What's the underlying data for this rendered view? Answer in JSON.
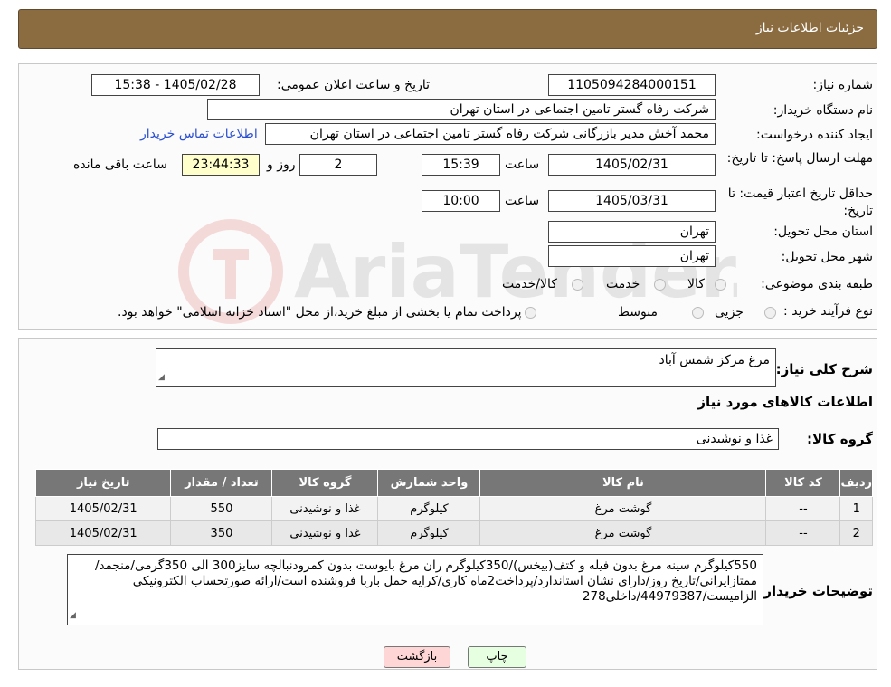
{
  "header": {
    "title": "جزئیات اطلاعات نیاز"
  },
  "labels": {
    "need_number": "شماره نیاز:",
    "announce_datetime": "تاریخ و ساعت اعلان عمومی:",
    "buyer_org": "نام دستگاه خریدار:",
    "requester": "ایجاد کننده درخواست:",
    "deadline": "مهلت ارسال پاسخ: تا تاریخ:",
    "price_validity": "حداقل تاریخ اعتبار قیمت: تا تاریخ:",
    "hour1": "ساعت",
    "hour2": "ساعت",
    "day_and": "روز و",
    "time_remaining": "ساعت باقی مانده",
    "province": "استان محل تحویل:",
    "city": "شهر محل تحویل:",
    "category": "طبقه بندی موضوعی:",
    "process_type": "نوع فرآیند خرید :",
    "payment_note": "پرداخت تمام یا بخشی از مبلغ خرید،از محل \"اسناد خزانه اسلامی\" خواهد بود."
  },
  "values": {
    "need_number": "1105094284000151",
    "announce_datetime": "1405/02/28 - 15:38",
    "buyer_org": "شرکت رفاه گستر تامین اجتماعی در استان تهران",
    "requester": "محمد آخش مدیر بازرگانی شرکت رفاه گستر تامین اجتماعی در استان تهران",
    "buyer_contact_link": "اطلاعات تماس خریدار",
    "deadline_date": "1405/02/31",
    "deadline_time": "15:39",
    "days": "2",
    "remaining": "23:44:33",
    "validity_date": "1405/03/31",
    "validity_time": "10:00",
    "province": "تهران",
    "city": "تهران"
  },
  "category_options": [
    "کالا",
    "خدمت",
    "کالا/خدمت"
  ],
  "process_options": [
    "جزیی",
    "متوسط"
  ],
  "description": {
    "label": "شرح کلی نیاز:",
    "value": "مرغ مرکز شمس آباد"
  },
  "goods_info_title": "اطلاعات کالاهای مورد نیاز",
  "goods_group": {
    "label": "گروه کالا:",
    "value": "غذا و نوشیدنی"
  },
  "table": {
    "headers": [
      "ردیف",
      "کد کالا",
      "نام کالا",
      "واحد شمارش",
      "گروه کالا",
      "تعداد / مقدار",
      "تاریخ نیاز"
    ],
    "rows": [
      [
        "1",
        "--",
        "گوشت مرغ",
        "کیلوگرم",
        "غذا و نوشیدنی",
        "550",
        "1405/02/31"
      ],
      [
        "2",
        "--",
        "گوشت مرغ",
        "کیلوگرم",
        "غذا و نوشیدنی",
        "350",
        "1405/02/31"
      ]
    ]
  },
  "buyer_notes": {
    "label": "توضیحات خریدار:",
    "value": "550کیلوگرم سینه مرغ بدون فیله و کتف(بیخس)/350کیلوگرم ران مرغ بایوست بدون کمرودنبالچه سایز300 الی 350گرمی/منجمد/ممتازایرانی/تاریخ روز/دارای نشان استاندارد/پرداخت2ماه کاری/کرایه حمل باربا فروشنده است/ارائه صورتحساب الکترونیکی الزامیست/44979387/داخلی278"
  },
  "buttons": {
    "print": "چاپ",
    "back": "بازگشت"
  },
  "watermark": "AriaTender.neT",
  "colors": {
    "header_bg": "#8b6b40",
    "remaining_bg": "#ffffcc",
    "back_button_bg": "#ffd6d6",
    "print_button_bg": "#e6ffe0",
    "link": "#2a4fd0"
  }
}
